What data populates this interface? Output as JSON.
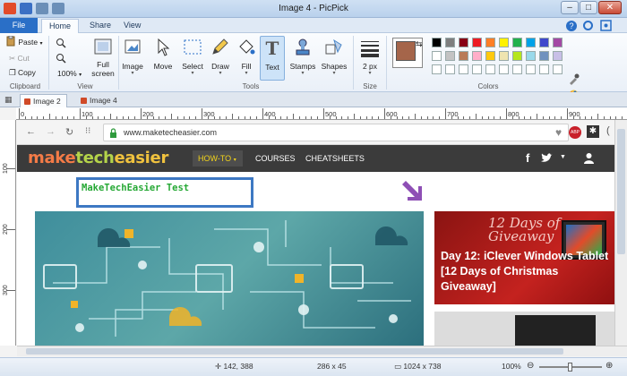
{
  "window": {
    "title": "Image 4 - PicPick"
  },
  "ribbon_tabs": [
    "File",
    "Home",
    "Share",
    "View"
  ],
  "clipboard": {
    "paste": "Paste",
    "cut": "Cut",
    "copy": "Copy",
    "label": "Clipboard"
  },
  "view_group": {
    "zoom": "100%",
    "full_screen": "Full\nscreen",
    "full_screen_line1": "Full",
    "full_screen_line2": "screen",
    "label": "View"
  },
  "tools_group": {
    "image": "Image",
    "move": "Move",
    "select": "Select",
    "draw": "Draw",
    "fill": "Fill",
    "text": "Text",
    "stamps": "Stamps",
    "shapes": "Shapes",
    "label": "Tools"
  },
  "size_group": {
    "value": "2 px",
    "label": "Size"
  },
  "colors_group": {
    "label": "Colors",
    "current": "#a5654a",
    "palette": [
      "#000000",
      "#7f7f7f",
      "#880015",
      "#ed1c24",
      "#ff7f27",
      "#fff200",
      "#22b14c",
      "#00a2e8",
      "#3f48cc",
      "#a349a4",
      "#ffffff",
      "#c3c3c3",
      "#b97a57",
      "#ffaec9",
      "#ffc90e",
      "#efe4b0",
      "#b5e61d",
      "#99d9ea",
      "#7092be",
      "#c8bfe7",
      "#ffffff",
      "#ffffff",
      "#ffffff",
      "#ffffff",
      "#ffffff",
      "#ffffff",
      "#ffffff",
      "#ffffff",
      "#ffffff",
      "#ffffff"
    ]
  },
  "doc_tabs": [
    "Image 2",
    "Image 4"
  ],
  "ruler_h": [
    "0",
    "100",
    "200",
    "300",
    "400",
    "500",
    "600",
    "700",
    "800",
    "900"
  ],
  "ruler_v": [
    "100",
    "200",
    "300"
  ],
  "browser": {
    "url": "www.maketecheasier.com",
    "abp": "ABP"
  },
  "site": {
    "logo_a": "make",
    "logo_b": "tech",
    "logo_c": "easier",
    "nav": [
      "HOW-TO",
      "COURSES",
      "CHEATSHEETS"
    ],
    "promo_script": "12 Days of Giveaway",
    "promo_title": "Day 12: iClever Windows Tablet [12 Days of Christmas Giveaway]"
  },
  "annotation": {
    "text": "MakeTechEasier Test"
  },
  "status": {
    "cursor": "142, 388",
    "selection": "286 x 45",
    "image_size": "1024 x 738",
    "zoom": "100%"
  }
}
